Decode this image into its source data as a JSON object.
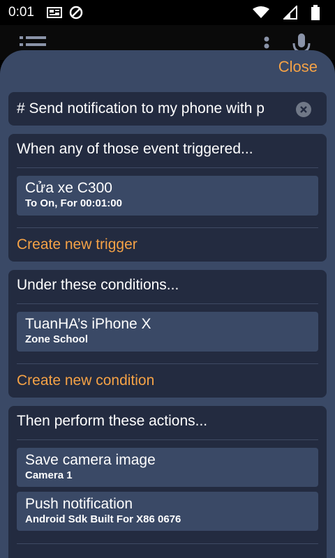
{
  "status_bar": {
    "time": "0:01",
    "icons_left": [
      "news-icon",
      "blocked-icon"
    ],
    "icons_right": [
      "wifi-icon",
      "cell-signal-icon",
      "battery-icon"
    ]
  },
  "app_bar": {
    "icons": [
      "menu-icon",
      "more-vert-icon",
      "mic-icon"
    ]
  },
  "sheet": {
    "close_label": "Close",
    "automation_name": "# Send notification to my phone with p",
    "triggers": {
      "title": "When any of those event triggered...",
      "items": [
        {
          "title": "Cửa xe C300",
          "subtitle": "To On, For 00:01:00"
        }
      ],
      "create_label": "Create new trigger"
    },
    "conditions": {
      "title": "Under these conditions...",
      "items": [
        {
          "title": "TuanHA’s iPhone X",
          "subtitle": "Zone School"
        }
      ],
      "create_label": "Create new condition"
    },
    "actions": {
      "title": "Then perform these actions...",
      "items": [
        {
          "title": "Save camera image",
          "subtitle": "Camera 1"
        },
        {
          "title": "Push notification",
          "subtitle": "Android Sdk Built For X86 0676"
        }
      ]
    }
  },
  "colors": {
    "accent": "#f5a246",
    "sheet_bg": "#3a4966",
    "section_bg": "#232b40"
  }
}
